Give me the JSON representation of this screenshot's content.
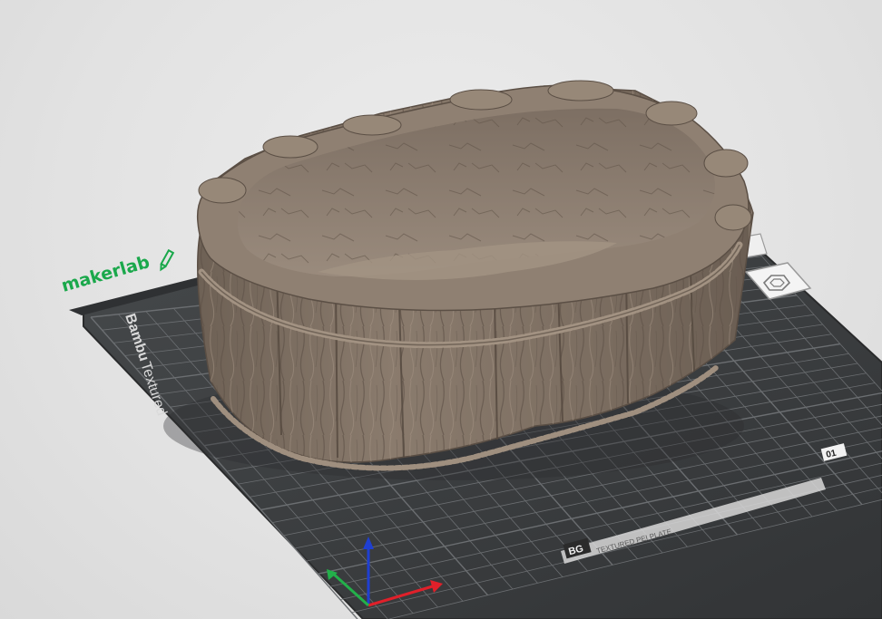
{
  "viewport": {
    "brand_label": "makerlab",
    "plate_label_top": "Bambu",
    "plate_label_bottom": "Textured",
    "plate_footer_left": "BG",
    "plate_footer_text": "TEXTURED PEI PLATE",
    "plate_id_label": "01",
    "colors": {
      "background": "#e3e3e3",
      "plate": "#3b3d3f",
      "grid_line": "#6b6e71",
      "model": "#8b7b6d",
      "brand_green": "#1aa84b",
      "axis_x": "#e0202a",
      "axis_y": "#23b04a",
      "axis_z": "#1f3fd1"
    },
    "icons": [
      "pencil-icon",
      "hexagon-plate-icon",
      "axis-gizmo"
    ]
  }
}
